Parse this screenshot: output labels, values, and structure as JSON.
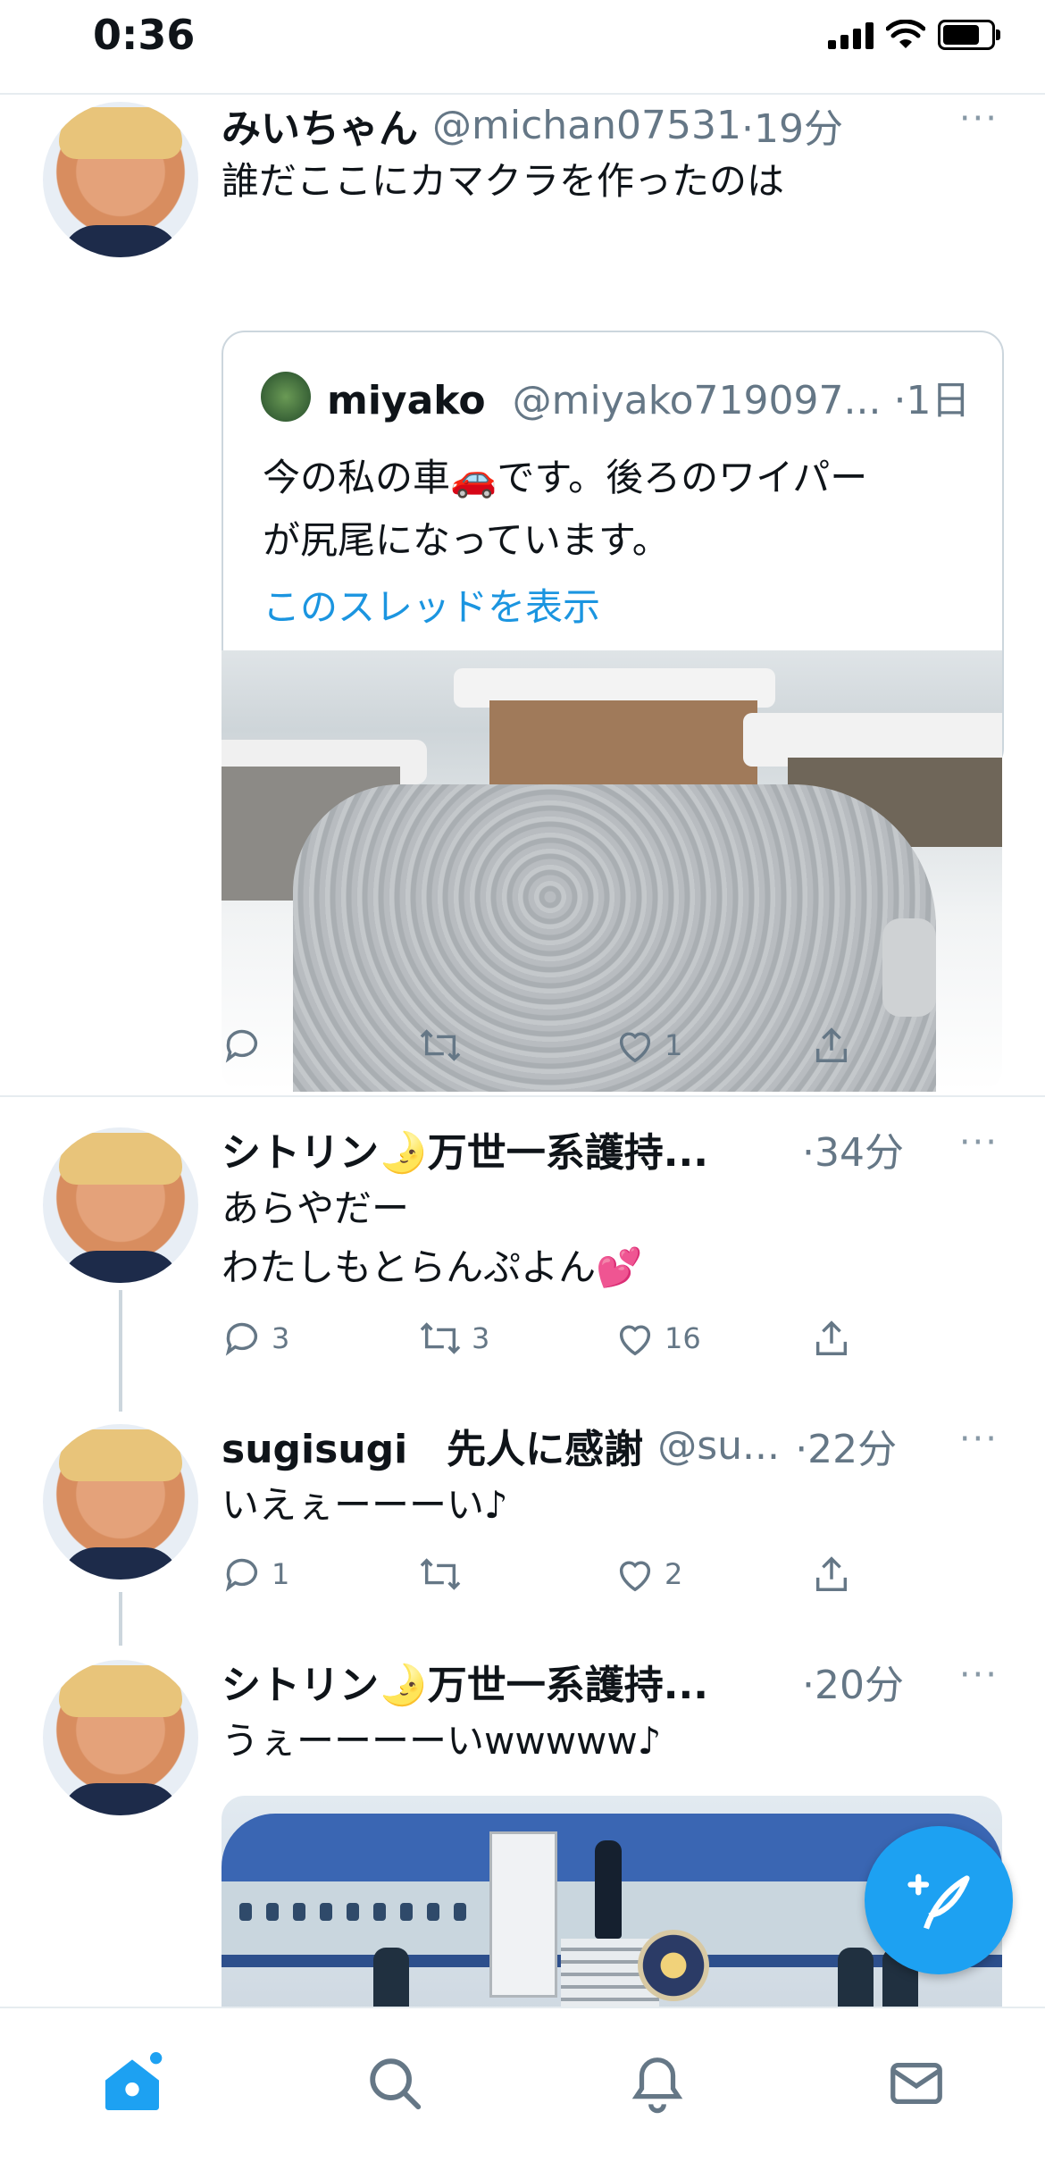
{
  "status_bar": {
    "time": "0:36"
  },
  "tweets": [
    {
      "name": "みいちゃん",
      "handle": "@michan07531",
      "time": "·19分",
      "text": "誰だここにカマクラを作ったのは",
      "quote": {
        "name": "miyako",
        "handle": "@miyako719097...",
        "time": "·1日",
        "text_line1": "今の私の車",
        "text_line1b": "です。後ろのワイパー",
        "text_line2": "が尻尾になっています。",
        "emoji": "🚗",
        "show_thread": "このスレッドを表示"
      },
      "actions": {
        "reply": "",
        "retweet": "",
        "like": "1"
      }
    },
    {
      "name": "シトリン🌛万世一系護持...",
      "handle": "",
      "time": "·34分",
      "text_line1": "あらやだー",
      "text_line2": "わたしもとらんぷよん💕",
      "actions": {
        "reply": "3",
        "retweet": "3",
        "like": "16"
      }
    },
    {
      "name": "sugisugi　先人に感謝",
      "handle": "@su...",
      "time": "·22分",
      "text": "いえぇーーーい♪",
      "actions": {
        "reply": "1",
        "retweet": "",
        "like": "2"
      }
    },
    {
      "name": "シトリン🌛万世一系護持...",
      "handle": "",
      "time": "·20分",
      "text": "うぇーーーーいwwwww♪"
    }
  ],
  "more_label": "···",
  "icons": {
    "reply": "reply-icon",
    "retweet": "retweet-icon",
    "like": "heart-icon",
    "share": "share-icon",
    "compose": "compose-icon",
    "tabs": [
      "home-icon",
      "search-icon",
      "notifications-icon",
      "messages-icon"
    ]
  },
  "colors": {
    "accent": "#1da1f2",
    "link": "#1b95e0",
    "muted": "#657786"
  }
}
